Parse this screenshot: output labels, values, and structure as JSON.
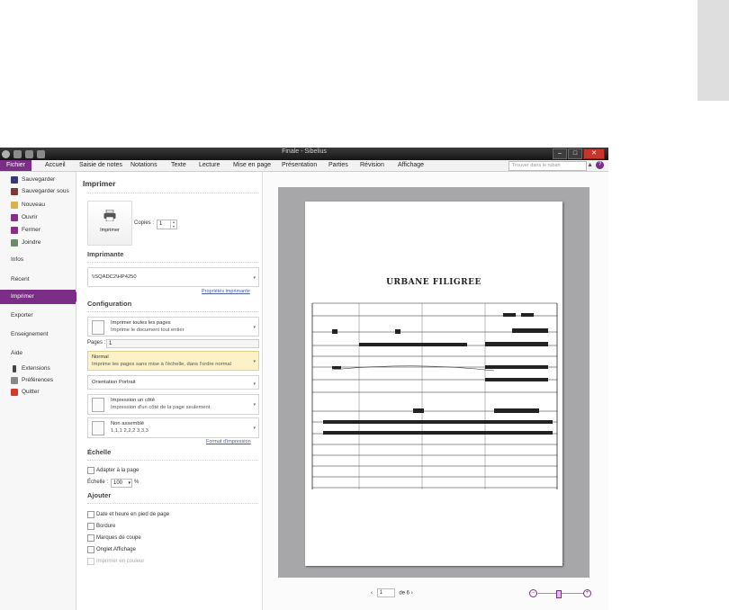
{
  "window": {
    "title": "Finale - Sibelius"
  },
  "ribbon": {
    "tabs": [
      "Fichier",
      "Accueil",
      "Saisie de notes",
      "Notations",
      "Texte",
      "Lecture",
      "Mise en page",
      "Présentation",
      "Parties",
      "Révision",
      "Affichage"
    ],
    "search_placeholder": "Trouver dans le ruban"
  },
  "nav": {
    "items": [
      {
        "label": "Sauvegarder",
        "icon": "save-icon",
        "color": "#3a3a7a"
      },
      {
        "label": "Sauvegarder sous",
        "icon": "save-as-icon",
        "color": "#7a3a3a"
      },
      {
        "label": "Nouveau",
        "icon": "new-document-icon",
        "color": "#d8b34a"
      },
      {
        "label": "Ouvrir",
        "icon": "open-folder-icon",
        "color": "#8a2e8a"
      },
      {
        "label": "Fermer",
        "icon": "close-file-icon",
        "color": "#8a2e8a"
      },
      {
        "label": "Joindre",
        "icon": "attach-icon",
        "color": "#6a8a6a"
      }
    ],
    "sections": [
      "Infos",
      "Récent",
      "Imprimer",
      "Exporter",
      "Enseignement",
      "Aide"
    ],
    "bottom_items": [
      {
        "label": "Extensions",
        "icon": "plugin-icon",
        "color": "#444"
      },
      {
        "label": "Préférences",
        "icon": "preferences-icon",
        "color": "#888"
      },
      {
        "label": "Quitter",
        "icon": "quit-icon",
        "color": "#d23a30"
      }
    ],
    "accent": "#7a2e86"
  },
  "print": {
    "heading": "Imprimer",
    "button_label": "Imprimer",
    "copies_label": "Copies :",
    "copies_value": "1",
    "printer_heading": "Imprimante",
    "printer_name": "\\\\SQADC2\\HP4250",
    "printer_props_link": "Propriétés imprimante",
    "config_heading": "Configuration",
    "pages_option": {
      "title": "Imprimer toutes les pages",
      "subtitle": "Imprime le document tout entier"
    },
    "pages_label": "Pages :",
    "pages_value": "1",
    "scale_option": {
      "title": "Normal",
      "subtitle": "Imprime les pages sans mise à l'échelle, dans l'ordre normal"
    },
    "orientation": "Orientation Portrait",
    "sides_option": {
      "title": "Impression un côté",
      "subtitle": "Impression d'un côté de la page seulement"
    },
    "collate_option": {
      "title": "Non assemblé",
      "subtitle": "1,1,1  2,2,2  3,3,3"
    },
    "format_link": "Format d'impression",
    "scale_heading": "Échelle",
    "fit_page": "Adapter à la page",
    "scale_label": "Échelle :",
    "scale_value": "100",
    "scale_unit": "%",
    "add_heading": "Ajouter",
    "add_options": [
      "Date et heure en pied de page",
      "Bordure",
      "Marques de coupe",
      "Onglet Affichage"
    ],
    "color_option": "Imprimer en couleur"
  },
  "preview": {
    "score_title": "URBANE FILIGREE",
    "page_current": "1",
    "page_of": "de 6"
  }
}
